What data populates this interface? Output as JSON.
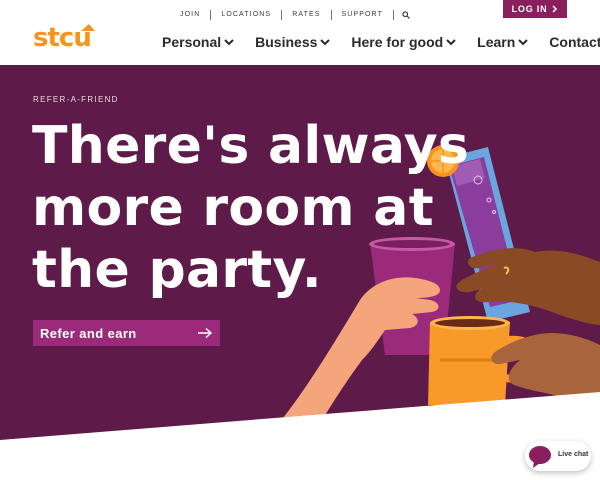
{
  "brand": {
    "logo_text": "stcu",
    "colors": {
      "orange": "#f7941d",
      "green": "#8dc63f",
      "plum": "#5e1a48",
      "magenta": "#8a1f5e",
      "cta": "#9b2b7a"
    }
  },
  "utility_nav": {
    "items": [
      "JOIN",
      "LOCATIONS",
      "RATES",
      "SUPPORT"
    ],
    "search_icon": "search-icon"
  },
  "login": {
    "label": "LOG IN",
    "icon": "chevron-right-icon"
  },
  "main_nav": {
    "items": [
      "Personal",
      "Business",
      "Here for good",
      "Learn",
      "Contact"
    ]
  },
  "hero": {
    "eyebrow": "REFER-A-FRIEND",
    "headline": "There's always more room at the party.",
    "cta_label": "Refer and earn",
    "cta_icon": "arrow-right-icon"
  },
  "live_chat": {
    "label": "Live chat",
    "icon": "chat-bubble-icon"
  }
}
